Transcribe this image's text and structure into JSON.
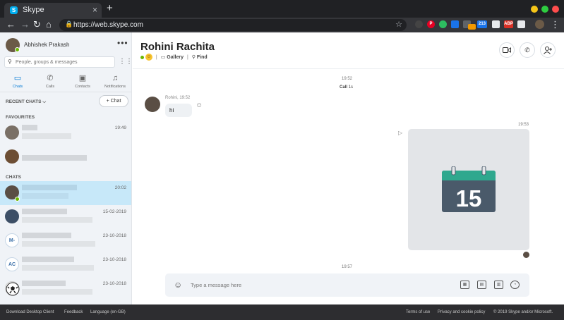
{
  "browser": {
    "tab_title": "Skype",
    "tab_close": "×",
    "new_tab": "+",
    "url": "https://web.skype.com",
    "back": "←",
    "forward": "→",
    "reload": "↻",
    "home": "⌂",
    "lock": "🔒",
    "star": "☆",
    "menu": "⋮",
    "ext_badge": "ABP",
    "ext_count": "213",
    "colors": {
      "minimize": "#f5c518",
      "maximize": "#2ecc40",
      "close": "#ff4d4d"
    }
  },
  "sidebar": {
    "profile_name": "Abhishek Prakash",
    "more": "•••",
    "search_placeholder": "People, groups & messages",
    "dialpad": "⋮⋮⋮",
    "nav": [
      {
        "label": "Chats",
        "icon": "chat-icon"
      },
      {
        "label": "Calls",
        "icon": "phone-icon"
      },
      {
        "label": "Contacts",
        "icon": "contacts-icon"
      },
      {
        "label": "Notifications",
        "icon": "bell-icon"
      }
    ],
    "recent_label": "RECENT CHATS ⌵",
    "new_chat_label": "+ Chat",
    "favourites_label": "FAVOURITES",
    "chats_label": "CHATS",
    "favourites": [
      {
        "time": "19:49"
      },
      {
        "time": ""
      }
    ],
    "chats": [
      {
        "time": "20:02",
        "initials": ""
      },
      {
        "time": "15-02-2019",
        "initials": ""
      },
      {
        "time": "23-10-2018",
        "initials": "M-"
      },
      {
        "time": "23-10-2018",
        "initials": "AC"
      },
      {
        "time": "23-10-2018",
        "initials": ""
      }
    ]
  },
  "conversation": {
    "title": "Rohini Rachita",
    "gallery_label": "Gallery",
    "find_label": "Find",
    "separator": "|",
    "timestamps": [
      "19:52",
      "19:53",
      "19:57"
    ],
    "call_label": "Call",
    "call_duration": "1s",
    "message_meta": "Rohini, 19:52",
    "message_text": "hi",
    "calendar_day": "15",
    "composer_placeholder": "Type a message here",
    "accent": "#0078d4"
  },
  "footer": {
    "download": "Download Desktop Client",
    "feedback": "Feedback",
    "language": "Language (en-GB)",
    "terms": "Terms of use",
    "privacy": "Privacy and cookie policy",
    "copyright": "© 2019 Skype and/or Microsoft."
  }
}
